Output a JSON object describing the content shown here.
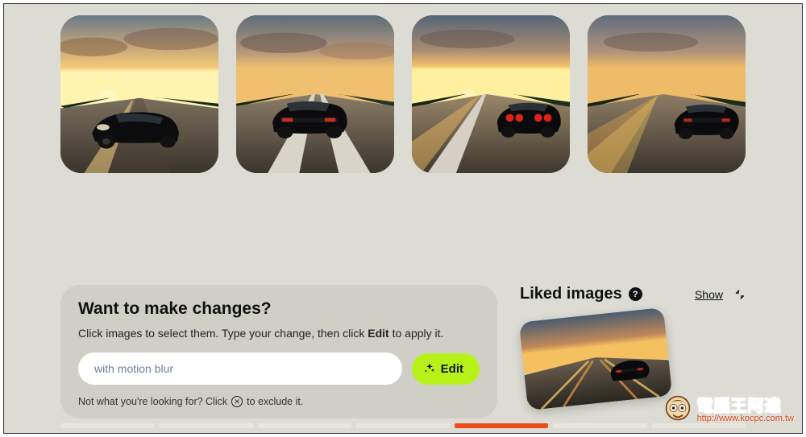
{
  "images": [
    {
      "alt": "black sports car front-side view on highway at sunset"
    },
    {
      "alt": "black sedan rear view driving on highway at sunset"
    },
    {
      "alt": "black coupe rear view with round taillights on highway at sunset"
    },
    {
      "alt": "black supercar rear view on highway at sunset"
    }
  ],
  "edit_panel": {
    "title": "Want to make changes?",
    "instruction_pre": "Click images to select them. Type your change, then click ",
    "instruction_bold": "Edit",
    "instruction_post": " to apply it.",
    "input_value": "with motion blur",
    "input_placeholder": "with motion blur",
    "button_label": "Edit",
    "exclude_pre": "Not what you're looking for? Click ",
    "exclude_post": " to exclude it."
  },
  "liked_panel": {
    "title": "Liked images",
    "help_tooltip": "?",
    "show_label": "Show",
    "thumb_alt": "black car on highway at sunset with light streaks"
  },
  "watermark": {
    "cn": "電腦王阿達",
    "url": "http://www.kocpc.com.tw"
  },
  "colors": {
    "page_bg": "#dcdcd4",
    "card_bg": "#cfcfc6",
    "accent": "#b6f21a",
    "progress_active": "#f14a1c"
  }
}
